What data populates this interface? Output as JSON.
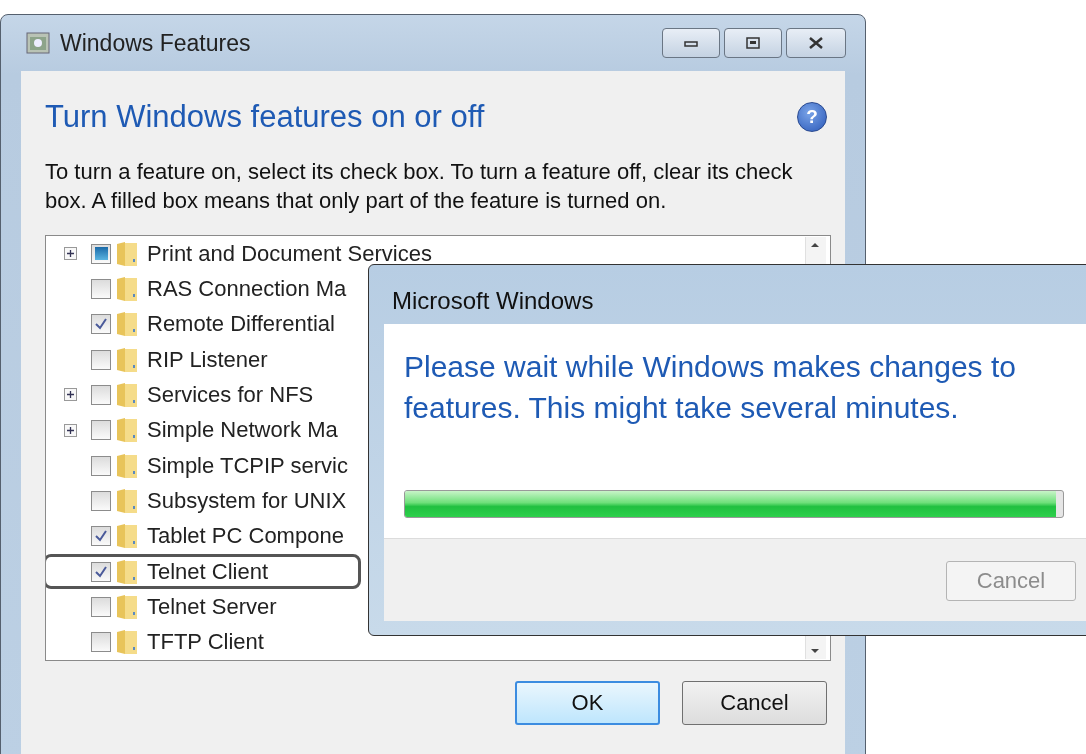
{
  "window": {
    "title": "Windows Features"
  },
  "heading": "Turn Windows features on or off",
  "help": "?",
  "description": "To turn a feature on, select its check box. To turn a feature off, clear its check box. A filled box means that only part of the feature is turned on.",
  "features": [
    {
      "name": "Print and Document Services",
      "expandable": true,
      "checked": false,
      "partial": true,
      "highlighted": false
    },
    {
      "name": "RAS Connection Ma",
      "expandable": false,
      "checked": false,
      "partial": false,
      "highlighted": false
    },
    {
      "name": "Remote Differential",
      "expandable": false,
      "checked": true,
      "partial": false,
      "highlighted": false
    },
    {
      "name": "RIP Listener",
      "expandable": false,
      "checked": false,
      "partial": false,
      "highlighted": false
    },
    {
      "name": "Services for NFS",
      "expandable": true,
      "checked": false,
      "partial": false,
      "highlighted": false
    },
    {
      "name": "Simple Network Ma",
      "expandable": true,
      "checked": false,
      "partial": false,
      "highlighted": false
    },
    {
      "name": "Simple TCPIP servic",
      "expandable": false,
      "checked": false,
      "partial": false,
      "highlighted": false
    },
    {
      "name": "Subsystem for UNIX",
      "expandable": false,
      "checked": false,
      "partial": false,
      "highlighted": false
    },
    {
      "name": "Tablet PC Compone",
      "expandable": false,
      "checked": true,
      "partial": false,
      "highlighted": false
    },
    {
      "name": "Telnet Client",
      "expandable": false,
      "checked": true,
      "partial": false,
      "highlighted": true
    },
    {
      "name": "Telnet Server",
      "expandable": false,
      "checked": false,
      "partial": false,
      "highlighted": false
    },
    {
      "name": "TFTP Client",
      "expandable": false,
      "checked": false,
      "partial": false,
      "highlighted": false
    }
  ],
  "buttons": [
    {
      "label": "OK",
      "default": true
    },
    {
      "label": "Cancel",
      "default": false
    }
  ],
  "dialog": {
    "title": "Microsoft Windows",
    "message": "Please wait while Windows makes changes to features. This might take several minutes.",
    "progress": {
      "level": 0.99
    },
    "cancel": {
      "label": "Cancel",
      "disabled": true
    }
  }
}
